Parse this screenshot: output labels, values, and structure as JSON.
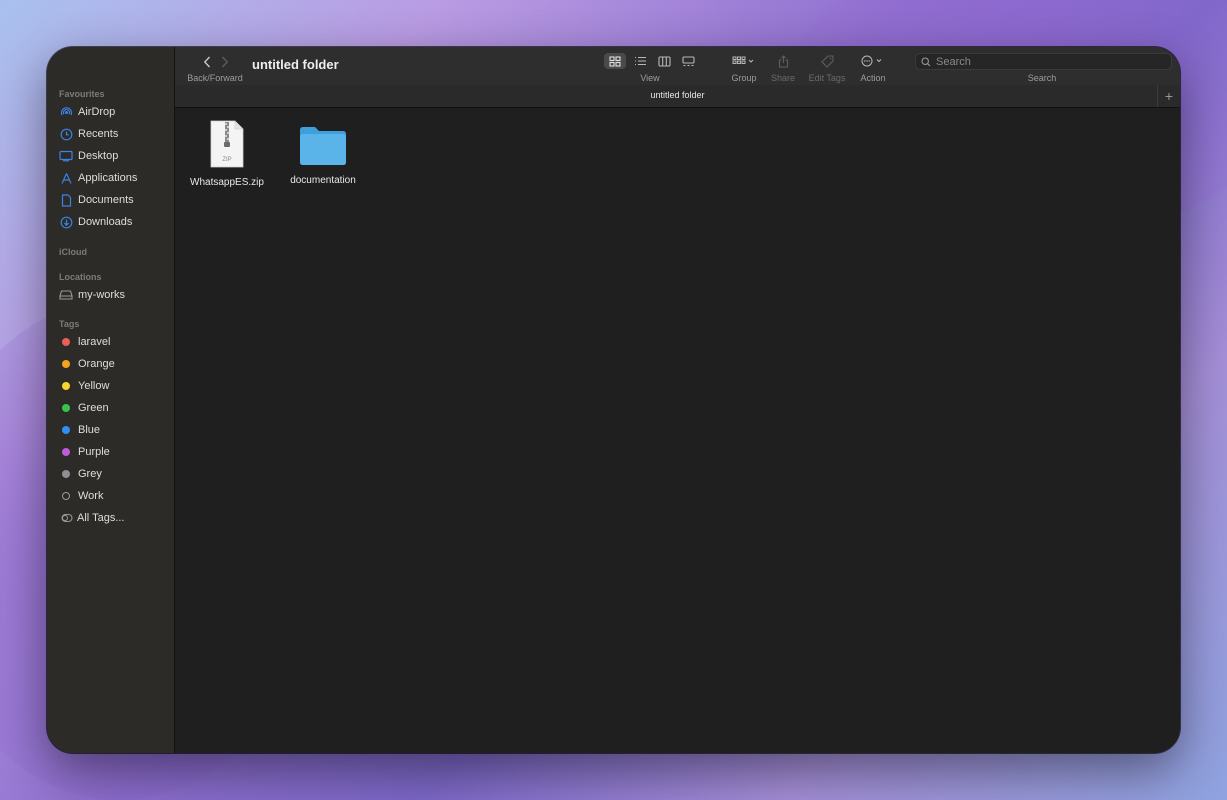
{
  "window": {
    "title": "untitled folder"
  },
  "toolbar": {
    "back_forward_label": "Back/Forward",
    "view_label": "View",
    "group_label": "Group",
    "share_label": "Share",
    "edit_tags_label": "Edit Tags",
    "action_label": "Action",
    "search_label": "Search",
    "search_placeholder": "Search"
  },
  "pathbar": {
    "title": "untitled folder"
  },
  "sidebar": {
    "favourites_header": "Favourites",
    "favourites": [
      {
        "label": "AirDrop",
        "icon": "airdrop-icon"
      },
      {
        "label": "Recents",
        "icon": "clock-icon"
      },
      {
        "label": "Desktop",
        "icon": "desktop-icon"
      },
      {
        "label": "Applications",
        "icon": "applications-icon"
      },
      {
        "label": "Documents",
        "icon": "document-icon"
      },
      {
        "label": "Downloads",
        "icon": "download-icon"
      }
    ],
    "icloud_header": "iCloud",
    "locations_header": "Locations",
    "locations": [
      {
        "label": "my-works",
        "icon": "drive-icon"
      }
    ],
    "tags_header": "Tags",
    "tags": [
      {
        "label": "laravel",
        "color": "#ec5f57"
      },
      {
        "label": "Orange",
        "color": "#f5a31d"
      },
      {
        "label": "Yellow",
        "color": "#f6d62e"
      },
      {
        "label": "Green",
        "color": "#37c44c"
      },
      {
        "label": "Blue",
        "color": "#2f8ff4"
      },
      {
        "label": "Purple",
        "color": "#bf5ad8"
      },
      {
        "label": "Grey",
        "color": "#8f8f94"
      },
      {
        "label": "Work",
        "color": ""
      },
      {
        "label": "All Tags...",
        "color": ""
      }
    ]
  },
  "files": [
    {
      "name": "WhatsappES.zip",
      "icon": "zip-file-icon",
      "badge": "ZIP"
    },
    {
      "name": "documentation",
      "icon": "folder-icon"
    }
  ],
  "colors": {
    "accent": "#3b82e6",
    "folder": "#5ab4ea"
  }
}
